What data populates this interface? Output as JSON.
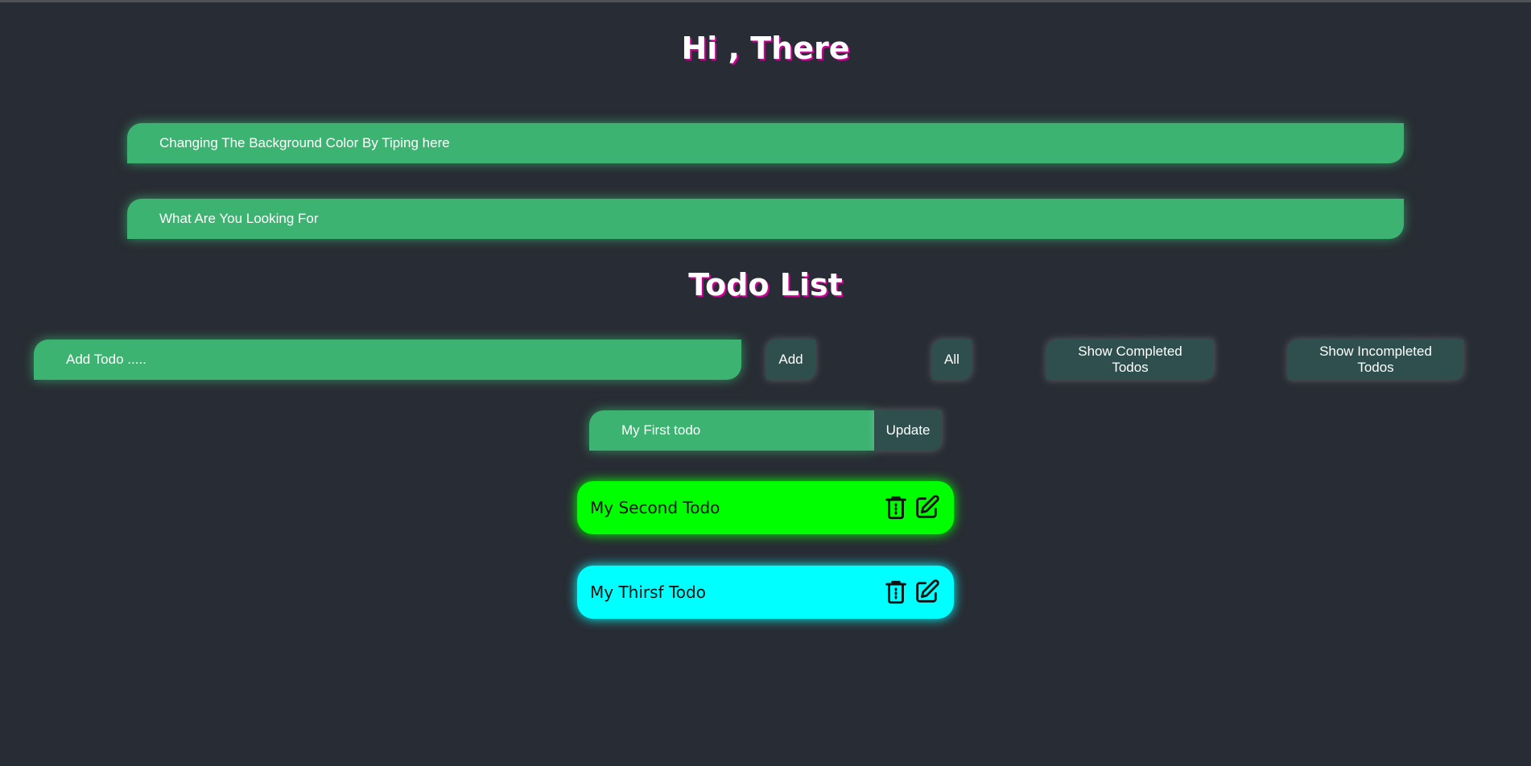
{
  "header": {
    "greeting": "Hi , There"
  },
  "inputs": {
    "bg_color_placeholder": "Changing The Background Color By Tiping here",
    "search_placeholder": "What Are You Looking For",
    "add_todo_placeholder": "Add Todo .....",
    "edit_todo_value": "My First todo"
  },
  "todo": {
    "title": "Todo List",
    "add_label": "Add",
    "filters": {
      "all_label": "All",
      "completed_label": "Show Completed Todos",
      "incompleted_label": "Show Incompleted Todos"
    },
    "update_label": "Update",
    "items": [
      {
        "text": "My Second Todo",
        "color": "#00ff00"
      },
      {
        "text": "My Thirsf Todo",
        "color": "#00ffff"
      }
    ]
  },
  "icons": {
    "delete": "trash-icon",
    "edit": "edit-icon"
  },
  "colors": {
    "background": "#282c34",
    "input_accent": "#3cb371",
    "button_bg": "#2f4f4f",
    "heading_shadow": "#d1009a"
  }
}
